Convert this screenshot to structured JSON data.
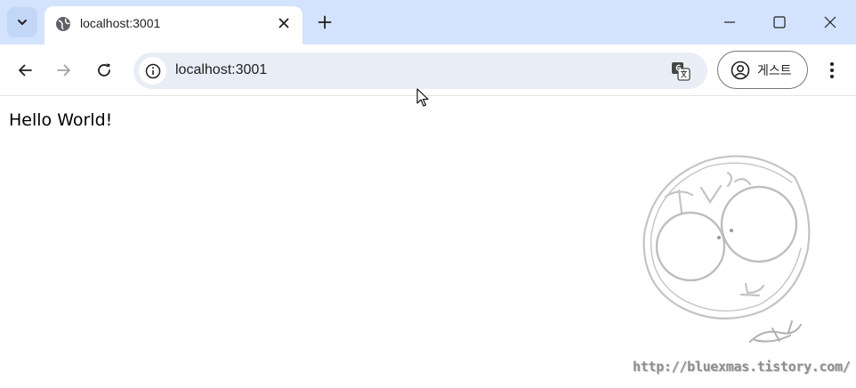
{
  "browser": {
    "tab": {
      "title": "localhost:3001",
      "favicon": "globe-icon"
    },
    "address_bar": {
      "url": "localhost:3001"
    },
    "profile": {
      "label": "게스트"
    },
    "colors": {
      "titlebar": "#d3e3fd",
      "omnibox": "#e9eef6"
    }
  },
  "page": {
    "text": "Hello World!"
  },
  "watermark": {
    "url": "http://bluexmas.tistory.com/"
  }
}
